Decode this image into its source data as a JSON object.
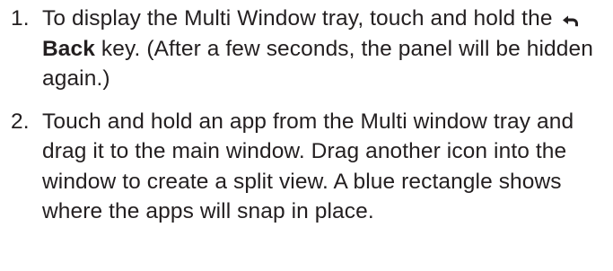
{
  "steps": [
    {
      "number": "1.",
      "text_before": "To display the Multi Window tray, touch and hold the",
      "icon": "back-arrow-icon",
      "key_label": "Back",
      "text_after": "key. (After a few seconds, the panel will be hidden again.)"
    },
    {
      "number": "2.",
      "text": "Touch and hold an app from the Multi window tray and drag it to the main window. Drag another icon into the window to create a split view. A blue rectangle shows where the apps will snap in place."
    }
  ],
  "colors": {
    "text": "#231f20",
    "icon": "#231f20"
  }
}
